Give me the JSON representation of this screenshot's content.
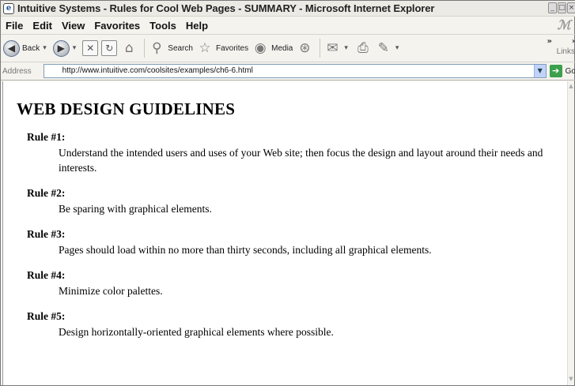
{
  "window": {
    "title": "Intuitive Systems - Rules for Cool Web Pages - SUMMARY - Microsoft Internet Explorer"
  },
  "menu": [
    "File",
    "Edit",
    "View",
    "Favorites",
    "Tools",
    "Help"
  ],
  "toolbar": {
    "back_label": "Back",
    "search_label": "Search",
    "favorites_label": "Favorites",
    "media_label": "Media",
    "links_label": "Links"
  },
  "address": {
    "label": "Address",
    "url": "http://www.intuitive.com/coolsites/examples/ch6-6.html",
    "go_label": "Go"
  },
  "page": {
    "heading": "WEB DESIGN GUIDELINES",
    "rules": [
      {
        "term": "Rule #1:",
        "desc": "Understand the intended users and uses of your Web site; then focus the design and layout around their needs and interests."
      },
      {
        "term": "Rule #2:",
        "desc": "Be sparing with graphical elements."
      },
      {
        "term": "Rule #3:",
        "desc": "Pages should load within no more than thirty seconds, including all graphical elements."
      },
      {
        "term": "Rule #4:",
        "desc": "Minimize color palettes."
      },
      {
        "term": "Rule #5:",
        "desc": "Design horizontally-oriented graphical elements where possible."
      }
    ]
  },
  "icons": {
    "app": "ie-page-icon",
    "back": "back-arrow-icon",
    "forward": "forward-arrow-icon",
    "stop": "stop-icon",
    "refresh": "refresh-icon",
    "home": "home-icon",
    "search": "magnifier-icon",
    "favorites": "star-icon",
    "media": "media-icon",
    "history": "history-icon",
    "mail": "mail-icon",
    "print": "printer-icon",
    "edit": "edit-icon",
    "go": "go-arrow-icon"
  }
}
